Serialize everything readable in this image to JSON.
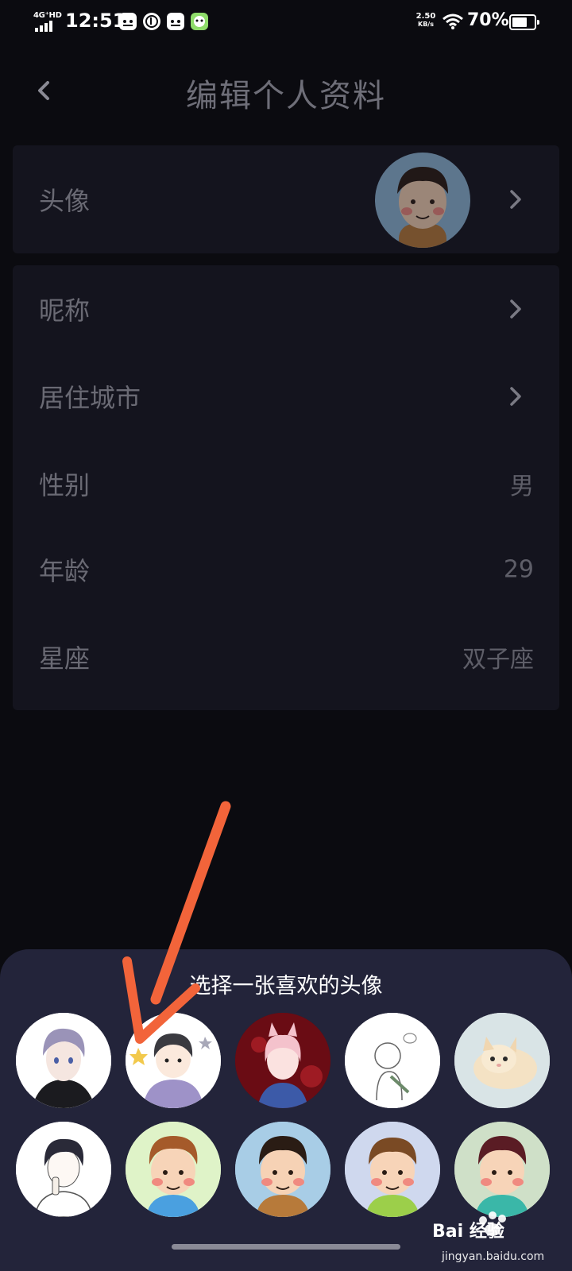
{
  "status_bar": {
    "network": "4G⁺HD",
    "time": "12:51",
    "speed_value": "2.50",
    "speed_unit": "KB/s",
    "battery": "70%",
    "battery_level": 0.7
  },
  "header": {
    "title": "编辑个人资料",
    "back_icon": "chevron-left-icon"
  },
  "profile": {
    "avatar_label": "头像",
    "rows": [
      {
        "label": "昵称",
        "value": "",
        "has_chevron": true
      },
      {
        "label": "居住城市",
        "value": "",
        "has_chevron": true
      },
      {
        "label": "性别",
        "value": "男",
        "has_chevron": false
      },
      {
        "label": "年龄",
        "value": "29",
        "has_chevron": false
      },
      {
        "label": "星座",
        "value": "双子座",
        "has_chevron": false
      }
    ]
  },
  "sheet": {
    "title": "选择一张喜欢的头像",
    "options": [
      "avatar-anime-boy-silver-hair",
      "avatar-cartoon-boy-stars",
      "avatar-fox-girl-red",
      "avatar-line-drawing-boy",
      "avatar-kitten",
      "avatar-sketch-boy",
      "avatar-cartoon-boy-curly",
      "avatar-cartoon-boy-brown-shirt",
      "avatar-cartoon-boy-green-shirt",
      "avatar-cartoon-boy-teal-shirt"
    ]
  },
  "colors": {
    "accent_arrow": "#f2643a",
    "sheet_bg": "#23243a",
    "card_bg": "#14141e"
  },
  "watermark": {
    "brand": "Bai 经验",
    "url": "jingyan.baidu.com"
  }
}
